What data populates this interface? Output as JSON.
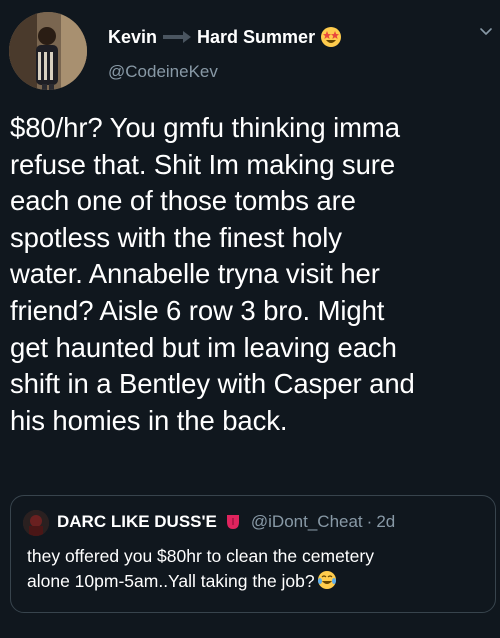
{
  "author": {
    "name_first": "Kevin",
    "name_second": "Hard Summer",
    "handle": "@CodeineKev",
    "icons": [
      "avatar-photo",
      "arrow-separator-icon",
      "star-struck-emoji-icon",
      "chevron-down-icon"
    ]
  },
  "tweet": {
    "body": "$80/hr? You gmfu thinking imma\nrefuse that. Shit Im making sure\neach one of those tombs are\nspotless with the finest holy\nwater. Annabelle tryna visit her\nfriend? Aisle 6 row 3 bro. Might\nget haunted but im leaving each\nshift in a Bentley with Casper and\nhis homies in the back."
  },
  "quoted": {
    "name": "DARC LIKE DUSS'E",
    "handle": "@iDont_Cheat",
    "separator": "·",
    "time": "2d",
    "text": "they offered you $80hr to clean the cemetery\nalone 10pm-5am..Yall taking the job?",
    "icons": [
      "tongue-emoji-icon",
      "tears-of-joy-emoji-icon"
    ]
  },
  "colors": {
    "background": "#10171e",
    "text": "#ffffff",
    "secondary": "#8899a6",
    "border": "#38444d"
  }
}
